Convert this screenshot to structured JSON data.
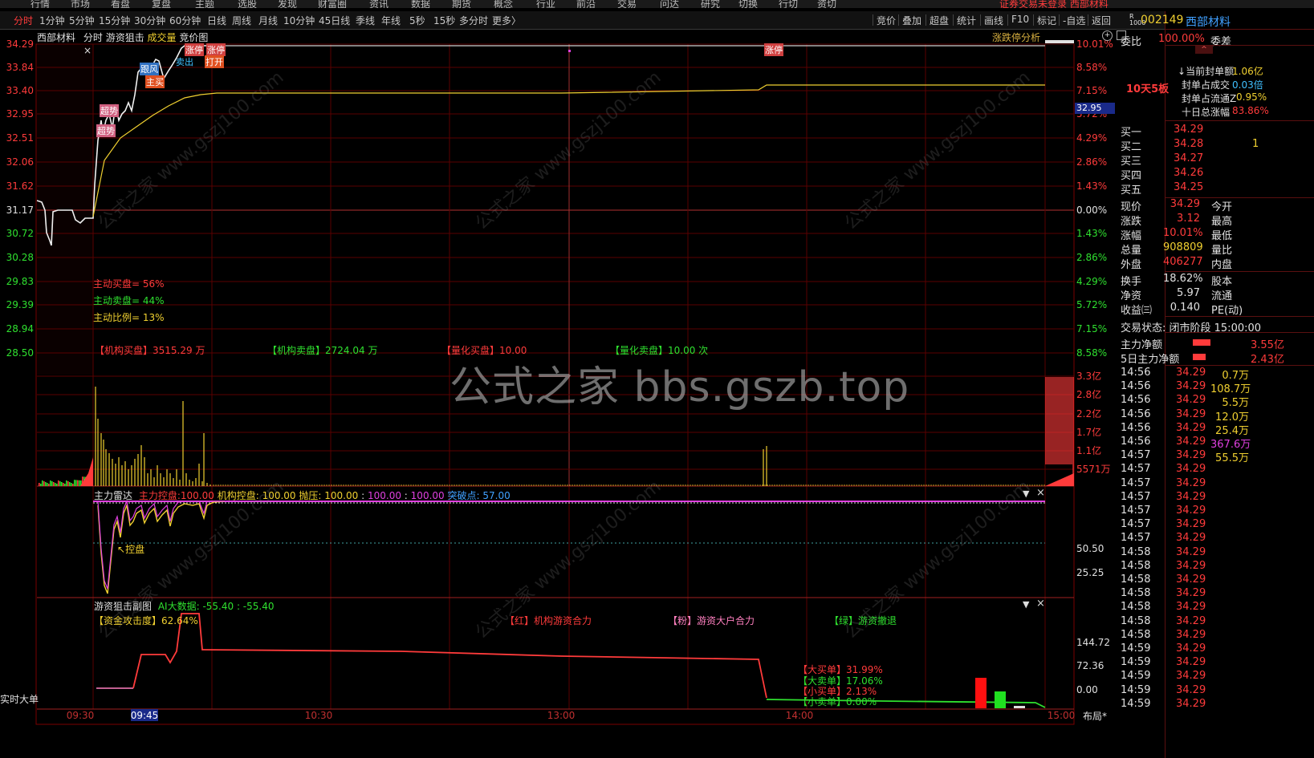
{
  "menubar": {
    "items": [
      "行情",
      "市场",
      "看盘",
      "复盘",
      "主题",
      "选股",
      "发现",
      "财富圈",
      "资讯",
      "数据",
      "期货",
      "概念",
      "行业",
      "前沿",
      "交易",
      "问达",
      "研究",
      "切换",
      "行切",
      "资切"
    ],
    "notice": "证券交易未登录  西部材料"
  },
  "tabbar": {
    "tabs": [
      "分时",
      "1分钟",
      "5分钟",
      "15分钟",
      "30分钟",
      "60分钟",
      "日线",
      "周线",
      "月线",
      "10分钟",
      "45日线",
      "季线",
      "年线",
      "5秒",
      "15秒",
      "多分时",
      "更多〉"
    ],
    "active_index": 0,
    "tools": [
      "竞价",
      "叠加",
      "超盘",
      "统计",
      "画线",
      "F10",
      "标记",
      "-自选",
      "返回"
    ]
  },
  "chart_header": {
    "stock_name": "西部材料",
    "items": [
      "分时",
      "游资狙击",
      "成交量",
      "竞价图"
    ],
    "analysis": "涨跌停分析"
  },
  "price_axis": {
    "left_labels": [
      "34.29",
      "33.84",
      "33.40",
      "32.95",
      "32.51",
      "32.06",
      "31.62",
      "31.17",
      "30.72",
      "30.28",
      "29.83",
      "29.39",
      "28.94",
      "28.50"
    ],
    "right_labels": [
      "10.01%",
      "8.58%",
      "7.15%",
      "5.72%",
      "4.29%",
      "2.86%",
      "1.43%",
      "0.00%",
      "1.43%",
      "2.86%",
      "4.29%",
      "5.72%",
      "7.15%",
      "8.58%"
    ],
    "cursor_price": "32.95"
  },
  "price_annotations": {
    "buy_ratio": "主动买盘= 56%",
    "sell_ratio": "主动卖盘= 44%",
    "ratio_label": "主动比例= 13%",
    "inst_buy": "【机构买盘】3515.29 万",
    "inst_sell": "【机构卖盘】2724.04 万",
    "quant_buy": "【量化买盘】10.00",
    "quant_sell": "【量化卖盘】10.00 次",
    "tags": [
      "涨停",
      "涨停",
      "打开",
      "卖出",
      "跟风",
      "主买",
      "超势",
      "超势"
    ],
    "limit_up_tag": "涨停"
  },
  "volume_axis": {
    "labels": [
      "3.3亿",
      "2.8亿",
      "2.2亿",
      "1.7亿",
      "1.1亿",
      "5571万"
    ]
  },
  "radar": {
    "title": "主力雷达",
    "main_label": "主力控盘:",
    "main_value": "100.00",
    "inst_label": "机构控盘: 100.00",
    "pressure": "抛压: 100.00",
    "v1": "100.00",
    "v2": "100.00",
    "breakout": "突破点: 57.00",
    "control_tag": "控盘",
    "axis": [
      "50.50",
      "25.25"
    ]
  },
  "sub": {
    "title": "游资狙击副图",
    "ai_label": "AI大数据: -55.40 : -55.40",
    "attack": "【资金攻击度】62.64%",
    "legend_red": "【红】机构游资合力",
    "legend_pink": "【粉】游资大户合力",
    "legend_green": "【绿】游资撤退",
    "big_buy": "【大买单】31.99%",
    "big_sell": "【大卖单】17.06%",
    "small_buy": "【小买单】2.13%",
    "small_sell": "【小卖单】0.00%",
    "axis": [
      "144.72",
      "72.36",
      "0.00"
    ],
    "realtime": "实时大单"
  },
  "time_axis": {
    "labels": [
      "09:30",
      "09:45",
      "10:30",
      "13:00",
      "14:00",
      "15:00"
    ],
    "layout": "布局*"
  },
  "watermark": {
    "main": "公式之家 bbs.gszb.top",
    "small": "公式之家 www.gszj100.com"
  },
  "quote": {
    "code": "002149",
    "name": "西部材料",
    "webi_label": "委比",
    "webi_value": "100.00%",
    "weicha_label": "委差",
    "board": "10天5板",
    "seal_amount_label": "当前封单额",
    "seal_amount_value": "1.06亿",
    "seal_deal_label": "封单占成交",
    "seal_deal_value": "0.03倍",
    "seal_float_label": "封单占流通Z",
    "seal_float_value": "0.95%",
    "ten_day_label": "十日总涨幅",
    "ten_day_value": "83.86%",
    "bids": [
      {
        "label": "买一",
        "price": "34.29",
        "vol": ""
      },
      {
        "label": "买二",
        "price": "34.28",
        "vol": "1"
      },
      {
        "label": "买三",
        "price": "34.27",
        "vol": ""
      },
      {
        "label": "买四",
        "price": "34.26",
        "vol": ""
      },
      {
        "label": "买五",
        "price": "34.25",
        "vol": ""
      }
    ],
    "stats_left": [
      {
        "label": "现价",
        "value": "34.29"
      },
      {
        "label": "涨跌",
        "value": "3.12"
      },
      {
        "label": "涨幅",
        "value": "10.01%"
      },
      {
        "label": "总量",
        "value": "908809"
      },
      {
        "label": "外盘",
        "value": "406277"
      }
    ],
    "stats_right": [
      "今开",
      "最高",
      "最低",
      "量比",
      "内盘"
    ],
    "stats2": [
      {
        "label": "换手",
        "value": "18.62%",
        "right": "股本"
      },
      {
        "label": "净资",
        "value": "5.97",
        "right": "流通"
      },
      {
        "label": "收益㈢",
        "value": "0.140",
        "right": "PE(动)"
      }
    ],
    "status": "交易状态: 闭市阶段 15:00:00",
    "main_net_label": "主力净额",
    "main_net_value": "3.55亿",
    "main5_label": "5日主力净额",
    "main5_value": "2.43亿",
    "ticks": [
      {
        "t": "14:56",
        "p": "34.29",
        "v": "0.7万",
        "c": "y"
      },
      {
        "t": "14:56",
        "p": "34.29",
        "v": "108.7万",
        "c": "y"
      },
      {
        "t": "14:56",
        "p": "34.29",
        "v": "5.5万",
        "c": "y"
      },
      {
        "t": "14:56",
        "p": "34.29",
        "v": "12.0万",
        "c": "y"
      },
      {
        "t": "14:56",
        "p": "34.29",
        "v": "25.4万",
        "c": "y"
      },
      {
        "t": "14:56",
        "p": "34.29",
        "v": "367.6万",
        "c": "m"
      },
      {
        "t": "14:57",
        "p": "34.29",
        "v": "55.5万",
        "c": "y"
      },
      {
        "t": "14:57",
        "p": "34.29",
        "v": "",
        "c": "y"
      },
      {
        "t": "14:57",
        "p": "34.29",
        "v": "",
        "c": "y"
      },
      {
        "t": "14:57",
        "p": "34.29",
        "v": "",
        "c": "y"
      },
      {
        "t": "14:57",
        "p": "34.29",
        "v": "",
        "c": "y"
      },
      {
        "t": "14:57",
        "p": "34.29",
        "v": "",
        "c": "y"
      },
      {
        "t": "14:57",
        "p": "34.29",
        "v": "",
        "c": "y"
      },
      {
        "t": "14:58",
        "p": "34.29",
        "v": "",
        "c": "y"
      },
      {
        "t": "14:58",
        "p": "34.29",
        "v": "",
        "c": "y"
      },
      {
        "t": "14:58",
        "p": "34.29",
        "v": "",
        "c": "y"
      },
      {
        "t": "14:58",
        "p": "34.29",
        "v": "",
        "c": "y"
      },
      {
        "t": "14:58",
        "p": "34.29",
        "v": "",
        "c": "y"
      },
      {
        "t": "14:58",
        "p": "34.29",
        "v": "",
        "c": "y"
      },
      {
        "t": "14:58",
        "p": "34.29",
        "v": "",
        "c": "y"
      },
      {
        "t": "14:59",
        "p": "34.29",
        "v": "",
        "c": "y"
      },
      {
        "t": "14:59",
        "p": "34.29",
        "v": "",
        "c": "y"
      },
      {
        "t": "14:59",
        "p": "34.29",
        "v": "",
        "c": "y"
      },
      {
        "t": "14:59",
        "p": "34.29",
        "v": "",
        "c": "y"
      },
      {
        "t": "14:59",
        "p": "34.29",
        "v": "",
        "c": "y"
      }
    ]
  },
  "colors": {
    "up": "#ff3b3b",
    "down": "#2fe02f",
    "yellow": "#f0d030",
    "grid": "#5a0000",
    "magenta": "#e040e0"
  }
}
